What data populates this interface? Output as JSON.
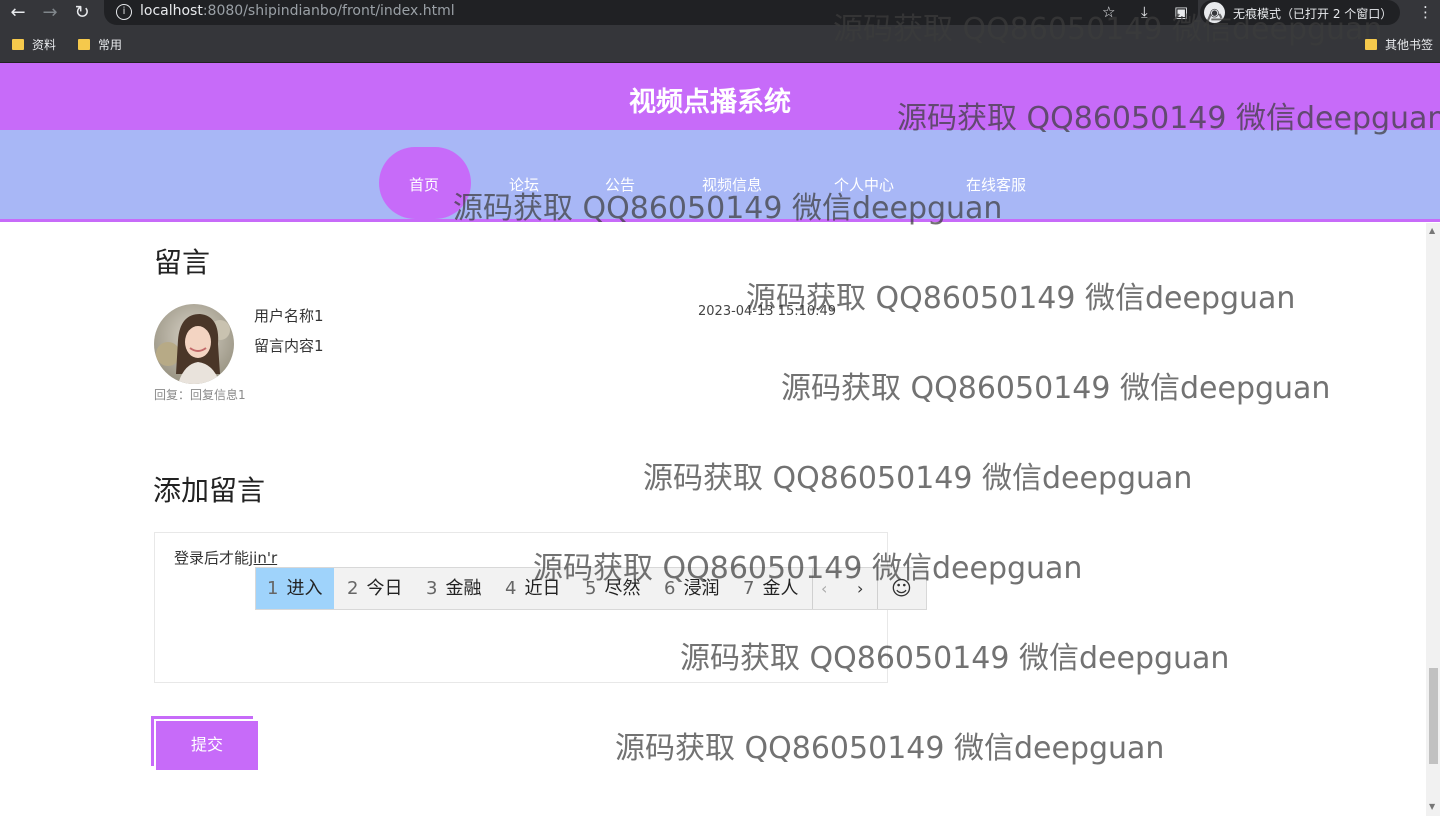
{
  "browser": {
    "url_host": "localhost",
    "url_rest": ":8080/shipindianbo/front/index.html",
    "incognito_label": "无痕模式（已打开 2 个窗口）",
    "bookmarks": [
      "资料",
      "常用"
    ],
    "other_bookmarks": "其他书签"
  },
  "header": {
    "title": "视频点播系统"
  },
  "nav": {
    "items": [
      "首页",
      "论坛",
      "公告",
      "视频信息",
      "个人中心",
      "在线客服"
    ]
  },
  "messages": {
    "heading": "留言",
    "items": [
      {
        "username": "用户名称1",
        "content": "留言内容1",
        "time": "2023-04-13 15:10:49",
        "reply": "回复：回复信息1"
      }
    ]
  },
  "add_message": {
    "heading": "添加留言",
    "textarea_text": "登录后才能",
    "composition_text": "jin'r",
    "submit_label": "提交"
  },
  "ime": {
    "candidates": [
      {
        "n": "1",
        "text": "进入"
      },
      {
        "n": "2",
        "text": "今日"
      },
      {
        "n": "3",
        "text": "金融"
      },
      {
        "n": "4",
        "text": "近日"
      },
      {
        "n": "5",
        "text": "尽然"
      },
      {
        "n": "6",
        "text": "浸润"
      },
      {
        "n": "7",
        "text": "金人"
      }
    ],
    "emoji_icon": "☺"
  },
  "watermark": "源码获取 QQ86050149 微信deepguan"
}
